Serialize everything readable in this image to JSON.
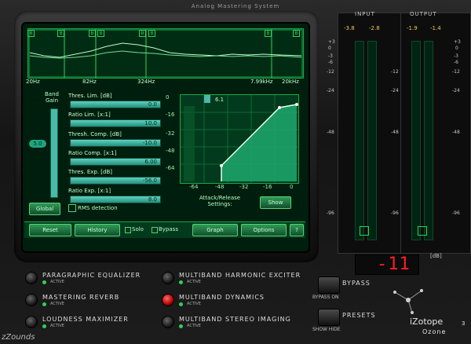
{
  "app": {
    "title": "Analog Mastering System"
  },
  "spectrum": {
    "freq_labels": [
      "20Hz",
      "82Hz",
      "324Hz",
      "7.99kHz",
      "20kHz"
    ],
    "band_markers": [
      "B",
      "B",
      "B",
      "B",
      "B",
      "B",
      "B",
      "B"
    ]
  },
  "band": {
    "label": "Band\nGain",
    "gain_value": "5.0"
  },
  "params": [
    {
      "label": "Thres. Lim. [dB]",
      "value": "0.0"
    },
    {
      "label": "Ratio Lim. [x:1]",
      "value": "10.0"
    },
    {
      "label": "Thresh. Comp. [dB]",
      "value": "-10.0"
    },
    {
      "label": "Ratio Comp. [x:1]",
      "value": "6.00"
    },
    {
      "label": "Thres. Exp. [dB]",
      "value": "-56.0"
    },
    {
      "label": "Ratio Exp. [x:1]",
      "value": "8.0"
    }
  ],
  "transfer": {
    "top_value": "6.1",
    "y_ticks": [
      "0",
      "-16",
      "-32",
      "-48",
      "-64"
    ],
    "x_ticks": [
      "-64",
      "-48",
      "-32",
      "-16",
      "0"
    ]
  },
  "buttons": {
    "global": "Global",
    "rms": "RMS detection",
    "attack_release": "Attack/Release\nSettings:",
    "show": "Show",
    "reset": "Reset",
    "history": "History",
    "solo": "Solo",
    "bypass": "Bypass",
    "graph": "Graph",
    "options": "Options",
    "help": "?"
  },
  "meters": {
    "input": {
      "label": "INPUT",
      "left": "-3.8",
      "right": "-2.8"
    },
    "output": {
      "label": "OUTPUT",
      "left": "-1.9",
      "right": "-1.4"
    },
    "scale": [
      "+3",
      "0",
      "-3",
      "-6",
      "-12",
      "-24",
      "-48",
      "-96"
    ],
    "scale_mid": [
      "-12",
      "-24",
      "-48",
      "-96"
    ]
  },
  "db_display": {
    "value": "-11",
    "unit": "[dB]"
  },
  "modules": [
    {
      "name": "PARAGRAPHIC EQUALIZER",
      "status": "ACTIVE",
      "active": false
    },
    {
      "name": "MASTERING REVERB",
      "status": "ACTIVE",
      "active": false
    },
    {
      "name": "LOUDNESS MAXIMIZER",
      "status": "ACTIVE",
      "active": false
    },
    {
      "name": "MULTIBAND HARMONIC EXCITER",
      "status": "ACTIVE",
      "active": false
    },
    {
      "name": "MULTIBAND DYNAMICS",
      "status": "ACTIVE",
      "active": true
    },
    {
      "name": "MULTIBAND STEREO IMAGING",
      "status": "ACTIVE",
      "active": false
    }
  ],
  "side": {
    "bypass": "BYPASS",
    "bypass_sub": "BYPASS  ON",
    "presets": "PRESETS",
    "presets_sub": "SHOW  HIDE"
  },
  "logo": {
    "brand": "iZotope",
    "product": "Ozone",
    "version": "3"
  },
  "watermark": "zZounds",
  "colors": {
    "accent": "#2fd05a",
    "screen": "#001e0d",
    "led_red": "#ff1f1f",
    "active_knob": "#d10000"
  }
}
